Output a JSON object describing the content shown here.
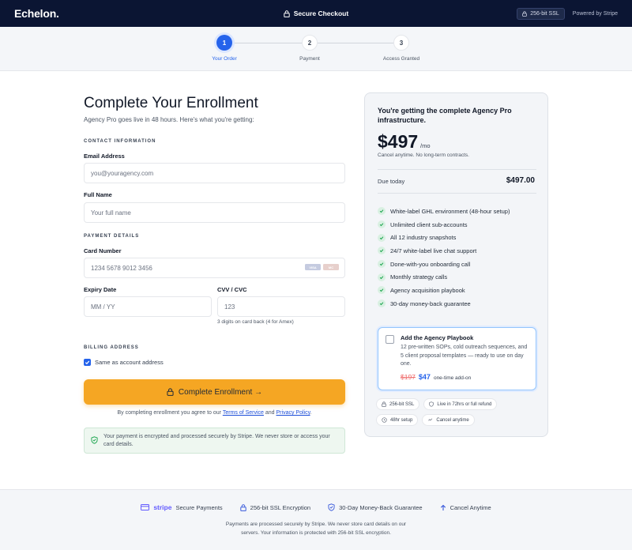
{
  "header": {
    "logo": "Echelon.",
    "title": "Secure Checkout",
    "ssl_badge": "256-bit SSL",
    "powered_by": "Powered by Stripe"
  },
  "steps": [
    {
      "number": "1",
      "label": "Your Order",
      "active": true
    },
    {
      "number": "2",
      "label": "Payment",
      "active": false
    },
    {
      "number": "3",
      "label": "Access Granted",
      "active": false
    }
  ],
  "form": {
    "title": "Complete Your Enrollment",
    "subtitle": "Agency Pro goes live in 48 hours. Here's what you're getting:",
    "contact_section": "CONTACT INFORMATION",
    "email_label": "Email Address",
    "email_placeholder": "you@youragency.com",
    "name_label": "Full Name",
    "name_placeholder": "Your full name",
    "payment_section": "PAYMENT DETAILS",
    "card_label": "Card Number",
    "card_placeholder": "1234 5678 9012 3456",
    "card_brands": [
      "VISA",
      "MC"
    ],
    "expiry_label": "Expiry Date",
    "expiry_placeholder": "MM / YY",
    "cvv_label": "CVV / CVC",
    "cvv_placeholder": "123",
    "cvv_hint": "3 digits on card back (4 for Amex)",
    "billing_section": "BILLING ADDRESS",
    "same_address_label": "Same as account address",
    "same_address_checked": true,
    "cta_label": "Complete Enrollment →",
    "agree_prefix": "By completing enrollment you agree to our ",
    "terms_link": "Terms of Service",
    "agree_and": " and ",
    "privacy_link": "Privacy Policy",
    "agree_suffix": ".",
    "secure_note": "Your payment is encrypted and processed securely by Stripe. We never store or access your card details."
  },
  "summary": {
    "headline": "You're getting the complete Agency Pro infrastructure.",
    "price": "$497",
    "per": "/mo",
    "cancel_note": "Cancel anytime. No long-term contracts.",
    "due_label": "Due today",
    "due_value": "$497.00",
    "features": [
      "White-label GHL environment (48-hour setup)",
      "Unlimited client sub-accounts",
      "All 12 industry snapshots",
      "24/7 white-label live chat support",
      "Done-with-you onboarding call",
      "Monthly strategy calls",
      "Agency acquisition playbook",
      "30-day money-back guarantee"
    ],
    "addon": {
      "title": "Add the Agency Playbook",
      "description": "12 pre-written SOPs, cold outreach sequences, and 5 client proposal templates — ready to use on day one.",
      "old_price": "$197",
      "new_price": "$47",
      "tag": "one-time add-on",
      "checked": false
    },
    "badges": [
      "256-bit SSL",
      "Live in 72hrs or full refund",
      "48hr setup",
      "Cancel anytime"
    ]
  },
  "footer": {
    "items": [
      {
        "brand": "stripe",
        "label": "Secure Payments"
      },
      {
        "label": "256-bit SSL Encryption"
      },
      {
        "label": "30-Day Money-Back Guarantee"
      },
      {
        "label": "Cancel Anytime"
      }
    ],
    "text_line1": "Payments are processed securely by Stripe. We never store card details on our",
    "text_line2": "servers. Your information is protected with 256-bit SSL encryption."
  },
  "colors": {
    "accent": "#2563eb",
    "cta": "#f5a623",
    "header_bg": "#0b1533",
    "success": "#16a34a",
    "strike_price": "#ef6b6b"
  }
}
